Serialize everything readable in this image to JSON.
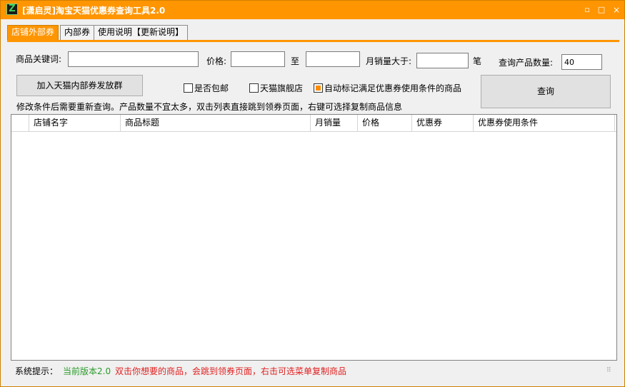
{
  "window": {
    "title": "[潇启灵]淘宝天猫优惠券查询工具2.0",
    "icon": "z-app-icon",
    "controls": {
      "minimize": "▫",
      "maximize": "□",
      "close": "×"
    }
  },
  "tabs": [
    {
      "label": "店铺外部券",
      "active": true
    },
    {
      "label": "内部券",
      "active": false
    },
    {
      "label": "使用说明【更新说明】",
      "active": false
    }
  ],
  "search": {
    "keyword_label": "商品关键词:",
    "keyword_value": "",
    "price_label": "价格:",
    "price_min": "",
    "price_to_label": "至",
    "price_max": "",
    "monthly_sales_label": "月销量大于:",
    "monthly_sales_value": "",
    "monthly_sales_unit": "笔",
    "count_label": "查询产品数量:",
    "count_value": "40"
  },
  "buttons": {
    "join_group": "加入天猫内部券发放群",
    "query": "查询"
  },
  "options": {
    "free_shipping": {
      "label": "是否包邮",
      "checked": false
    },
    "tmall_flagship": {
      "label": "天猫旗舰店",
      "checked": false
    },
    "auto_mark": {
      "label": "自动标记满足优惠券使用条件的商品",
      "checked": true
    }
  },
  "hint": "修改条件后需要重新查询。产品数量不宜太多，双击列表直接跳到领券页面，右键可选择复制商品信息",
  "table": {
    "columns": [
      "",
      "店铺名字",
      "商品标题",
      "月销量",
      "价格",
      "优惠券",
      "优惠券使用条件"
    ],
    "rows": []
  },
  "status": {
    "label": "系统提示：",
    "version": "当前版本2.0",
    "message": "双击你想要的商品，会跳到领券页面，右击可选菜单复制商品"
  },
  "colors": {
    "accent": "#ff9500",
    "version_text": "#2a9a2a",
    "message_text": "#e02020"
  }
}
